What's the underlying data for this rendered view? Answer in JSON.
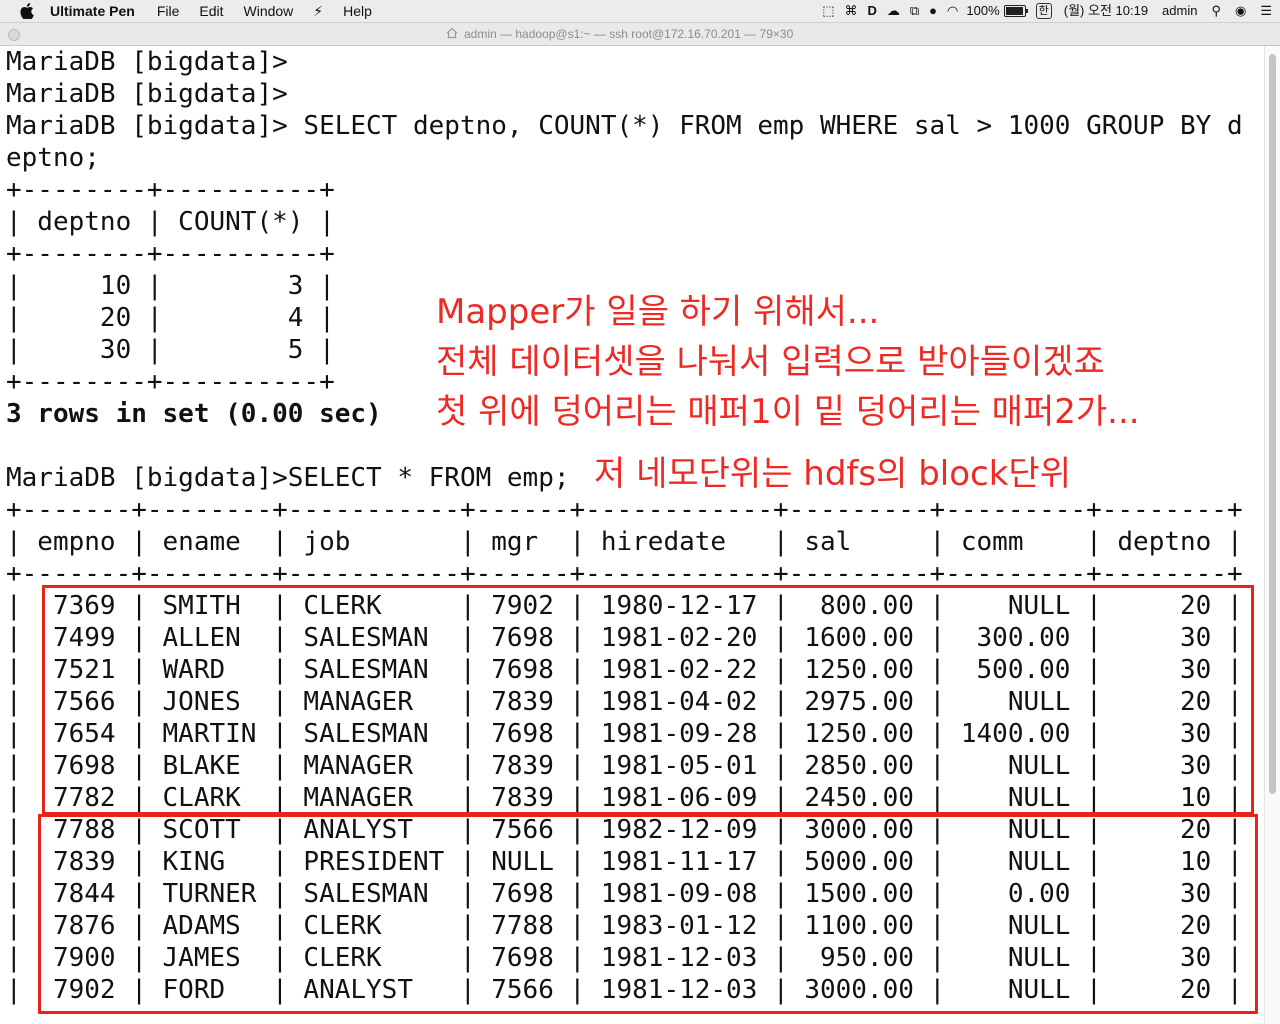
{
  "menubar": {
    "app_name": "Ultimate Pen",
    "items": [
      "File",
      "Edit",
      "Window",
      "Help"
    ],
    "battery_percent": "100%",
    "ime": "한",
    "clock": "(월) 오전 10:19",
    "user": "admin"
  },
  "window": {
    "title": "admin — hadoop@s1:~ — ssh root@172.16.70.201 — 79×30"
  },
  "terminal": {
    "lines": [
      "MariaDB [bigdata]>",
      "MariaDB [bigdata]>",
      "MariaDB [bigdata]> SELECT deptno, COUNT(*) FROM emp WHERE sal > 1000 GROUP BY d",
      "eptno;",
      "+--------+----------+",
      "| deptno | COUNT(*) |",
      "+--------+----------+",
      "|     10 |        3 |",
      "|     20 |        4 |",
      "|     30 |        5 |",
      "+--------+----------+",
      "3 rows in set (0.00 sec)",
      "",
      "MariaDB [bigdata]>SELECT * FROM emp;",
      "+-------+--------+-----------+------+------------+---------+---------+--------+",
      "| empno | ename  | job       | mgr  | hiredate   | sal     | comm    | deptno |",
      "+-------+--------+-----------+------+------------+---------+---------+--------+",
      "|  7369 | SMITH  | CLERK     | 7902 | 1980-12-17 |  800.00 |    NULL |     20 |",
      "|  7499 | ALLEN  | SALESMAN  | 7698 | 1981-02-20 | 1600.00 |  300.00 |     30 |",
      "|  7521 | WARD   | SALESMAN  | 7698 | 1981-02-22 | 1250.00 |  500.00 |     30 |",
      "|  7566 | JONES  | MANAGER   | 7839 | 1981-04-02 | 2975.00 |    NULL |     20 |",
      "|  7654 | MARTIN | SALESMAN  | 7698 | 1981-09-28 | 1250.00 | 1400.00 |     30 |",
      "|  7698 | BLAKE  | MANAGER   | 7839 | 1981-05-01 | 2850.00 |    NULL |     30 |",
      "|  7782 | CLARK  | MANAGER   | 7839 | 1981-06-09 | 2450.00 |    NULL |     10 |",
      "|  7788 | SCOTT  | ANALYST   | 7566 | 1982-12-09 | 3000.00 |    NULL |     20 |",
      "|  7839 | KING   | PRESIDENT | NULL | 1981-11-17 | 5000.00 |    NULL |     10 |",
      "|  7844 | TURNER | SALESMAN  | 7698 | 1981-09-08 | 1500.00 |    0.00 |     30 |",
      "|  7876 | ADAMS  | CLERK     | 7788 | 1983-01-12 | 1100.00 |    NULL |     20 |",
      "|  7900 | JAMES  | CLERK     | 7698 | 1981-12-03 |  950.00 |    NULL |     30 |",
      "|  7902 | FORD   | ANALYST   | 7566 | 1981-12-03 | 3000.00 |    NULL |     20 |"
    ],
    "bold_lines": [
      11
    ]
  },
  "annotations": {
    "line1": "Mapper가 일을 하기 위해서...",
    "line2": "전체 데이터셋을 나눠서 입력으로 받아들이겠죠",
    "line3": "첫 위에 덩어리는 매퍼1이 밑 덩어리는 매퍼2가...",
    "line4": "저 네모단위는 hdfs의 block단위",
    "color": "#ee2a24"
  }
}
